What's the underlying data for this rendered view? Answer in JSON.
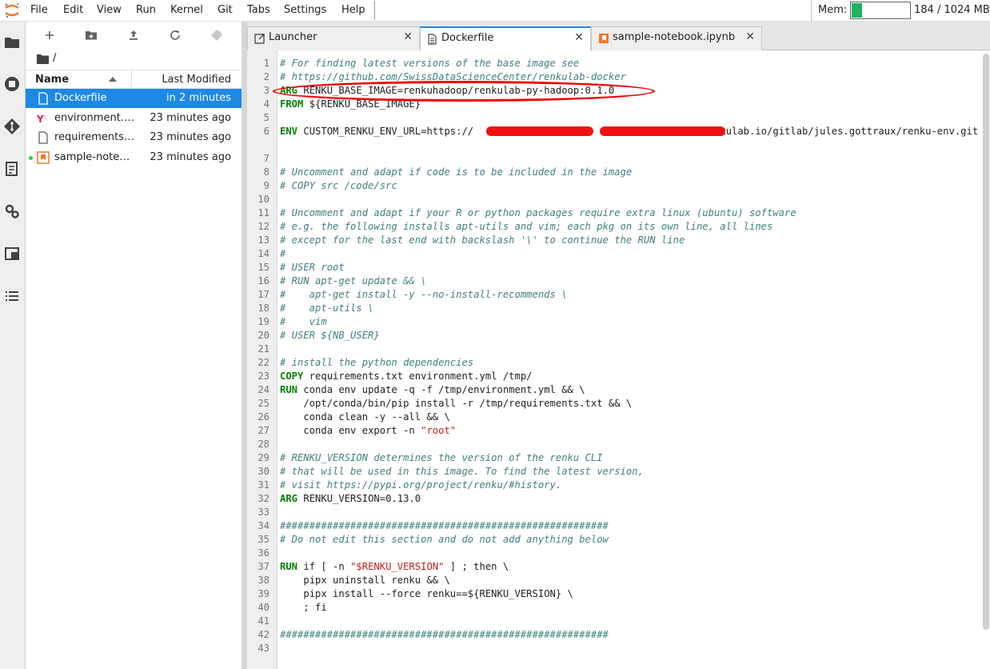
{
  "menubar": {
    "items": [
      "File",
      "Edit",
      "View",
      "Run",
      "Kernel",
      "Git",
      "Tabs",
      "Settings",
      "Help"
    ],
    "memory": {
      "label": "Mem:",
      "text": "184 / 1024 MB",
      "fraction": 0.18
    }
  },
  "filebrowser": {
    "breadcrumb": "/",
    "columns": {
      "name": "Name",
      "modified": "Last Modified"
    },
    "files": [
      {
        "name": "Dockerfile",
        "modified": "in 2 minutes",
        "icon": "file-icon",
        "selected": true,
        "running": false
      },
      {
        "name": "environment.yml",
        "modified": "23 minutes ago",
        "icon": "yaml-icon",
        "selected": false,
        "running": false
      },
      {
        "name": "requirements.txt",
        "modified": "23 minutes ago",
        "icon": "file-icon",
        "selected": false,
        "running": false
      },
      {
        "name": "sample-notebook.ipynb",
        "modified": "23 minutes ago",
        "icon": "notebook-icon",
        "selected": false,
        "running": true
      }
    ]
  },
  "tabs": [
    {
      "label": "Launcher",
      "icon": "launcher-icon",
      "active": false
    },
    {
      "label": "Dockerfile",
      "icon": "file-icon",
      "active": true
    },
    {
      "label": "sample-notebook.ipynb",
      "icon": "notebook-icon",
      "active": false
    }
  ],
  "editor": {
    "lines": [
      {
        "n": "1",
        "parts": [
          [
            "com",
            "# For finding latest versions of the base image see"
          ]
        ]
      },
      {
        "n": "2",
        "parts": [
          [
            "com",
            "# https://github.com/SwissDataScienceCenter/renkulab-docker"
          ]
        ]
      },
      {
        "n": "3",
        "parts": [
          [
            "kw",
            "ARG"
          ],
          [
            "",
            " RENKU_BASE_IMAGE=renkuhadoop/renkulab-py-hadoop:0.1.0"
          ]
        ]
      },
      {
        "n": "4",
        "parts": [
          [
            "kw",
            "FROM"
          ],
          [
            "",
            " ${RENKU_BASE_IMAGE}"
          ]
        ]
      },
      {
        "n": "5",
        "parts": []
      },
      {
        "n": "6",
        "parts": [
          [
            "kw",
            "ENV"
          ],
          [
            "",
            " CUSTOM_RENKU_ENV_URL=https://                 :                    @renkulab.io/gitlab/jules.gottraux/renku-env.git"
          ]
        ],
        "wrap": true
      },
      {
        "n": "7",
        "parts": []
      },
      {
        "n": "8",
        "parts": [
          [
            "com",
            "# Uncomment and adapt if code is to be included in the image"
          ]
        ]
      },
      {
        "n": "9",
        "parts": [
          [
            "com",
            "# COPY src /code/src"
          ]
        ]
      },
      {
        "n": "10",
        "parts": []
      },
      {
        "n": "11",
        "parts": [
          [
            "com",
            "# Uncomment and adapt if your R or python packages require extra linux (ubuntu) software"
          ]
        ]
      },
      {
        "n": "12",
        "parts": [
          [
            "com",
            "# e.g. the following installs apt-utils and vim; each pkg on its own line, all lines"
          ]
        ]
      },
      {
        "n": "13",
        "parts": [
          [
            "com",
            "# except for the last end with backslash '\\' to continue the RUN line"
          ]
        ]
      },
      {
        "n": "14",
        "parts": [
          [
            "com",
            "#"
          ]
        ]
      },
      {
        "n": "15",
        "parts": [
          [
            "com",
            "# USER root"
          ]
        ]
      },
      {
        "n": "16",
        "parts": [
          [
            "com",
            "# RUN apt-get update && \\"
          ]
        ]
      },
      {
        "n": "17",
        "parts": [
          [
            "com",
            "#    apt-get install -y --no-install-recommends \\"
          ]
        ]
      },
      {
        "n": "18",
        "parts": [
          [
            "com",
            "#    apt-utils \\"
          ]
        ]
      },
      {
        "n": "19",
        "parts": [
          [
            "com",
            "#    vim"
          ]
        ]
      },
      {
        "n": "20",
        "parts": [
          [
            "com",
            "# USER ${NB_USER}"
          ]
        ]
      },
      {
        "n": "21",
        "parts": []
      },
      {
        "n": "22",
        "parts": [
          [
            "com",
            "# install the python dependencies"
          ]
        ]
      },
      {
        "n": "23",
        "parts": [
          [
            "kw",
            "COPY"
          ],
          [
            "",
            " requirements.txt environment.yml /tmp/"
          ]
        ]
      },
      {
        "n": "24",
        "parts": [
          [
            "kw",
            "RUN"
          ],
          [
            "",
            " conda env update -q -f /tmp/environment.yml && \\"
          ]
        ]
      },
      {
        "n": "25",
        "parts": [
          [
            "",
            "    /opt/conda/bin/pip install -r /tmp/requirements.txt && \\"
          ]
        ]
      },
      {
        "n": "26",
        "parts": [
          [
            "",
            "    conda clean -y --all && \\"
          ]
        ]
      },
      {
        "n": "27",
        "parts": [
          [
            "",
            "    conda env export -n "
          ],
          [
            "str",
            "\"root\""
          ]
        ]
      },
      {
        "n": "28",
        "parts": []
      },
      {
        "n": "29",
        "parts": [
          [
            "com",
            "# RENKU_VERSION determines the version of the renku CLI"
          ]
        ]
      },
      {
        "n": "30",
        "parts": [
          [
            "com",
            "# that will be used in this image. To find the latest version,"
          ]
        ]
      },
      {
        "n": "31",
        "parts": [
          [
            "com",
            "# visit https://pypi.org/project/renku/#history."
          ]
        ]
      },
      {
        "n": "32",
        "parts": [
          [
            "kw",
            "ARG"
          ],
          [
            "",
            " RENKU_VERSION=0.13.0"
          ]
        ]
      },
      {
        "n": "33",
        "parts": []
      },
      {
        "n": "34",
        "parts": [
          [
            "com",
            "########################################################"
          ]
        ]
      },
      {
        "n": "35",
        "parts": [
          [
            "com",
            "# Do not edit this section and do not add anything below"
          ]
        ]
      },
      {
        "n": "36",
        "parts": []
      },
      {
        "n": "37",
        "parts": [
          [
            "kw",
            "RUN"
          ],
          [
            "",
            " if [ -n "
          ],
          [
            "str",
            "\"$RENKU_VERSION\""
          ],
          [
            "",
            " ] ; then \\"
          ]
        ]
      },
      {
        "n": "38",
        "parts": [
          [
            "",
            "    pipx uninstall renku && \\"
          ]
        ]
      },
      {
        "n": "39",
        "parts": [
          [
            "",
            "    pipx install --force renku==${RENKU_VERSION} \\"
          ]
        ]
      },
      {
        "n": "40",
        "parts": [
          [
            "",
            "    ; fi"
          ]
        ]
      },
      {
        "n": "41",
        "parts": []
      },
      {
        "n": "42",
        "parts": [
          [
            "com",
            "########################################################"
          ]
        ]
      },
      {
        "n": "43",
        "parts": []
      }
    ]
  },
  "colors": {
    "accent": "#1e88e5",
    "memory_fill": "#1fb35c",
    "annotation_red": "#ee0000",
    "comment": "#408080",
    "keyword": "#008000",
    "string": "#ba2121"
  }
}
